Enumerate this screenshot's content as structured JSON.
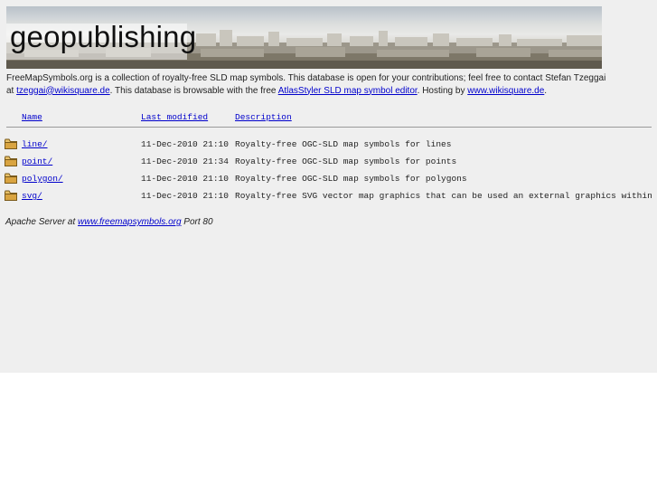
{
  "banner": {
    "logo_part1": "geo",
    "logo_part2": "publishing"
  },
  "intro": {
    "text1": "FreeMapSymbols.org is a collection of royalty-free SLD map symbols. This database is open for your contributions; feel free to contact Stefan Tzeggai",
    "text2": "at ",
    "email_link": "tzeggai@wikisquare.de",
    "text3": ". This database is browsable with the free ",
    "editor_link": "AtlasStyler SLD map symbol editor",
    "text4": ". Hosting by ",
    "host_link": "www.wikisquare.de",
    "text5": "."
  },
  "listing": {
    "headers": {
      "name": "Name",
      "modified": "Last modified",
      "description": "Description"
    },
    "rows": [
      {
        "name": "line/",
        "modified": "11-Dec-2010 21:10",
        "description": "Royalty-free OGC-SLD map symbols for lines",
        "icon": "folder-icon"
      },
      {
        "name": "point/",
        "modified": "11-Dec-2010 21:34",
        "description": "Royalty-free OGC-SLD map symbols for points",
        "icon": "folder-icon"
      },
      {
        "name": "polygon/",
        "modified": "11-Dec-2010 21:10",
        "description": "Royalty-free OGC-SLD map symbols for polygons",
        "icon": "folder-icon"
      },
      {
        "name": "svg/",
        "modified": "11-Dec-2010 21:10",
        "description": "Royalty-free SVG vector map graphics that can be used an external graphics within SLD",
        "icon": "folder-icon"
      }
    ]
  },
  "footer": {
    "prefix": "Apache Server at ",
    "link": "www.freemapsymbols.org",
    "suffix": " Port 80"
  },
  "colors": {
    "link": "#0000cc",
    "page_bg": "#efefef",
    "folder": "#d9a441"
  }
}
